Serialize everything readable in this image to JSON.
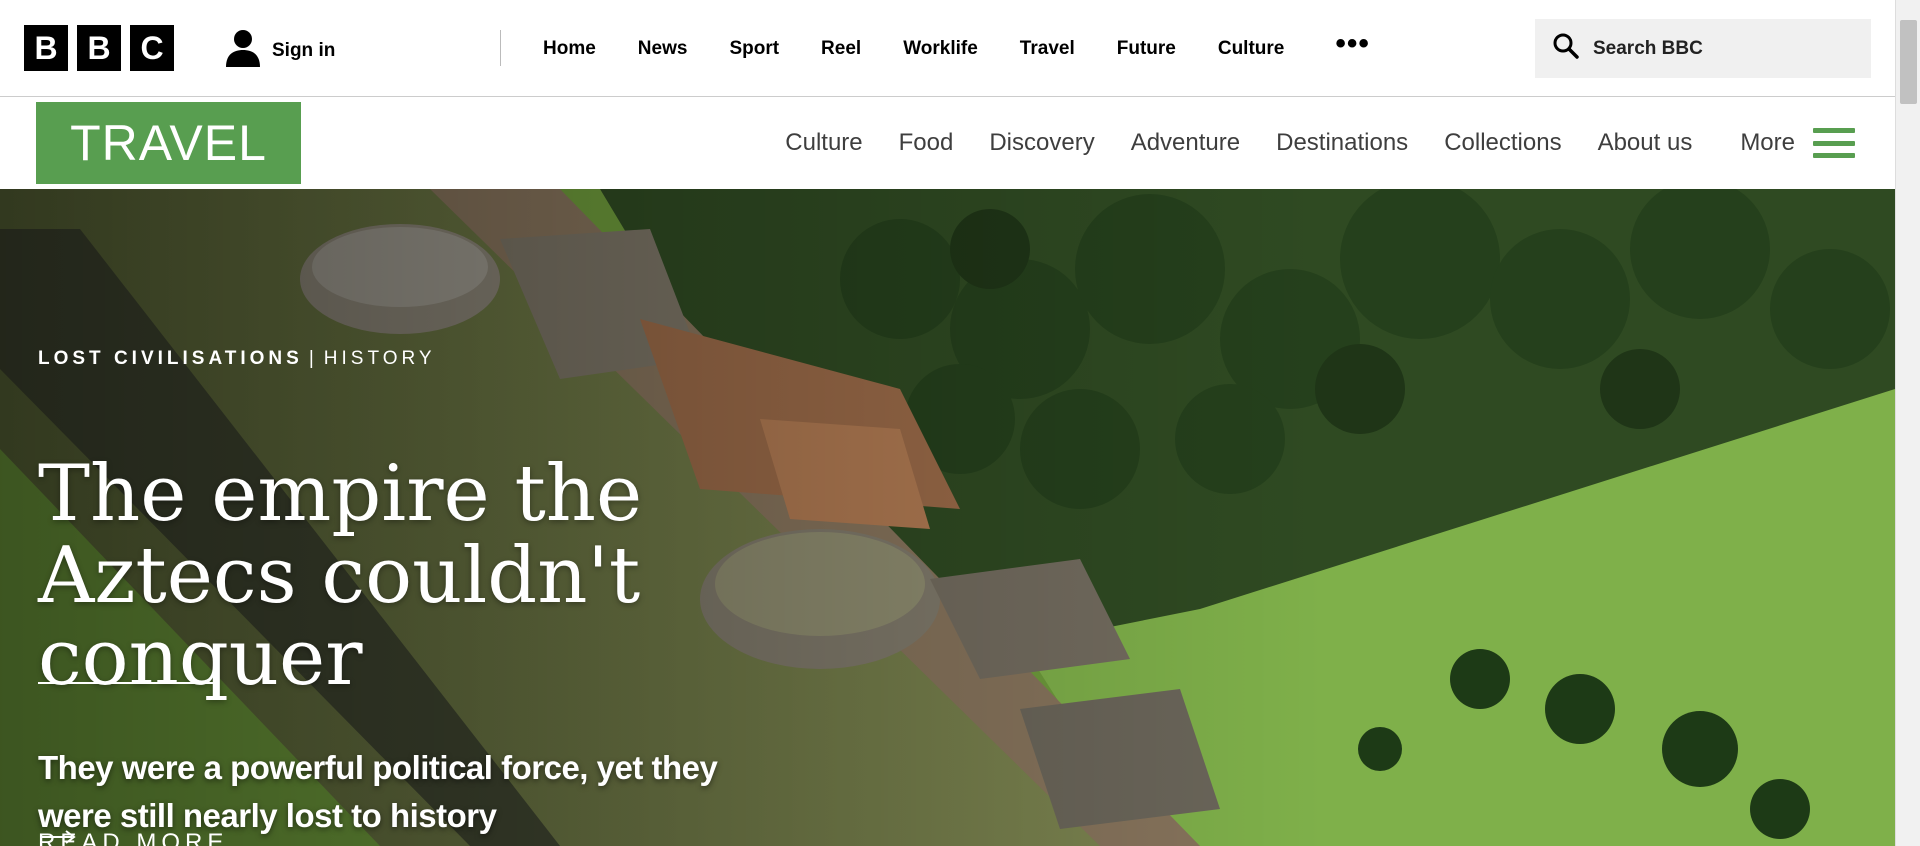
{
  "bbc": {
    "logo_letters": [
      "B",
      "B",
      "C"
    ],
    "sign_in": "Sign in",
    "nav": [
      "Home",
      "News",
      "Sport",
      "Reel",
      "Worklife",
      "Travel",
      "Future",
      "Culture"
    ],
    "more_dots": "•••",
    "search_placeholder": "Search BBC"
  },
  "travel": {
    "logo": "TRAVEL",
    "brand_color": "#589e50",
    "nav": [
      "Culture",
      "Food",
      "Discovery",
      "Adventure",
      "Destinations",
      "Collections",
      "About us"
    ],
    "more": "More"
  },
  "hero": {
    "kicker_primary": "LOST CIVILISATIONS",
    "kicker_separator": "|",
    "kicker_secondary": "HISTORY",
    "headline": "The empire the Aztecs couldn't conquer",
    "dek": "They were a powerful political force, yet they were still nearly lost to history",
    "read_more": "READ MORE"
  },
  "icons": {
    "user": "user-icon",
    "search": "search-icon",
    "menu": "hamburger-menu-icon",
    "arrow": "arrow-right-icon"
  }
}
